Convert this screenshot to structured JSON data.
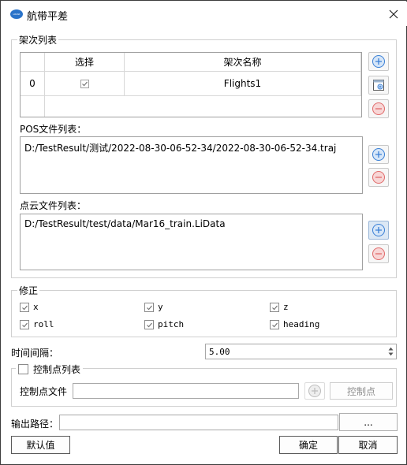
{
  "window": {
    "title": "航带平差",
    "logo_icon": "app-logo-icon",
    "close_icon": "close-icon"
  },
  "flights": {
    "legend": "架次列表",
    "columns": [
      "选择",
      "架次名称"
    ],
    "rows": [
      {
        "index": "0",
        "checked": true,
        "name": "Flights1"
      }
    ]
  },
  "pos": {
    "label": "POS文件列表：",
    "items": [
      "D:/TestResult/测试/2022-08-30-06-52-34/2022-08-30-06-52-34.traj"
    ]
  },
  "pointcloud": {
    "label": "点云文件列表：",
    "items": [
      "D:/TestResult/test/data/Mar16_train.LiData"
    ]
  },
  "correction": {
    "legend": "修正",
    "options": [
      {
        "label": "x",
        "checked": true
      },
      {
        "label": "y",
        "checked": true
      },
      {
        "label": "z",
        "checked": true
      },
      {
        "label": "roll",
        "checked": true
      },
      {
        "label": "pitch",
        "checked": true
      },
      {
        "label": "heading",
        "checked": true
      }
    ]
  },
  "interval": {
    "label": "时间间隔：",
    "value": "5.00"
  },
  "control": {
    "legend": "控制点列表",
    "checked": false,
    "file_label": "控制点文件",
    "file_value": "",
    "button": "控制点"
  },
  "output": {
    "label": "输出路径：",
    "value": "",
    "browse": "..."
  },
  "footer": {
    "default": "默认值",
    "ok": "确定",
    "cancel": "取消"
  },
  "colors": {
    "accent": "#3a7fd5",
    "remove": "#e06a6a",
    "border": "#a0a0a0"
  }
}
